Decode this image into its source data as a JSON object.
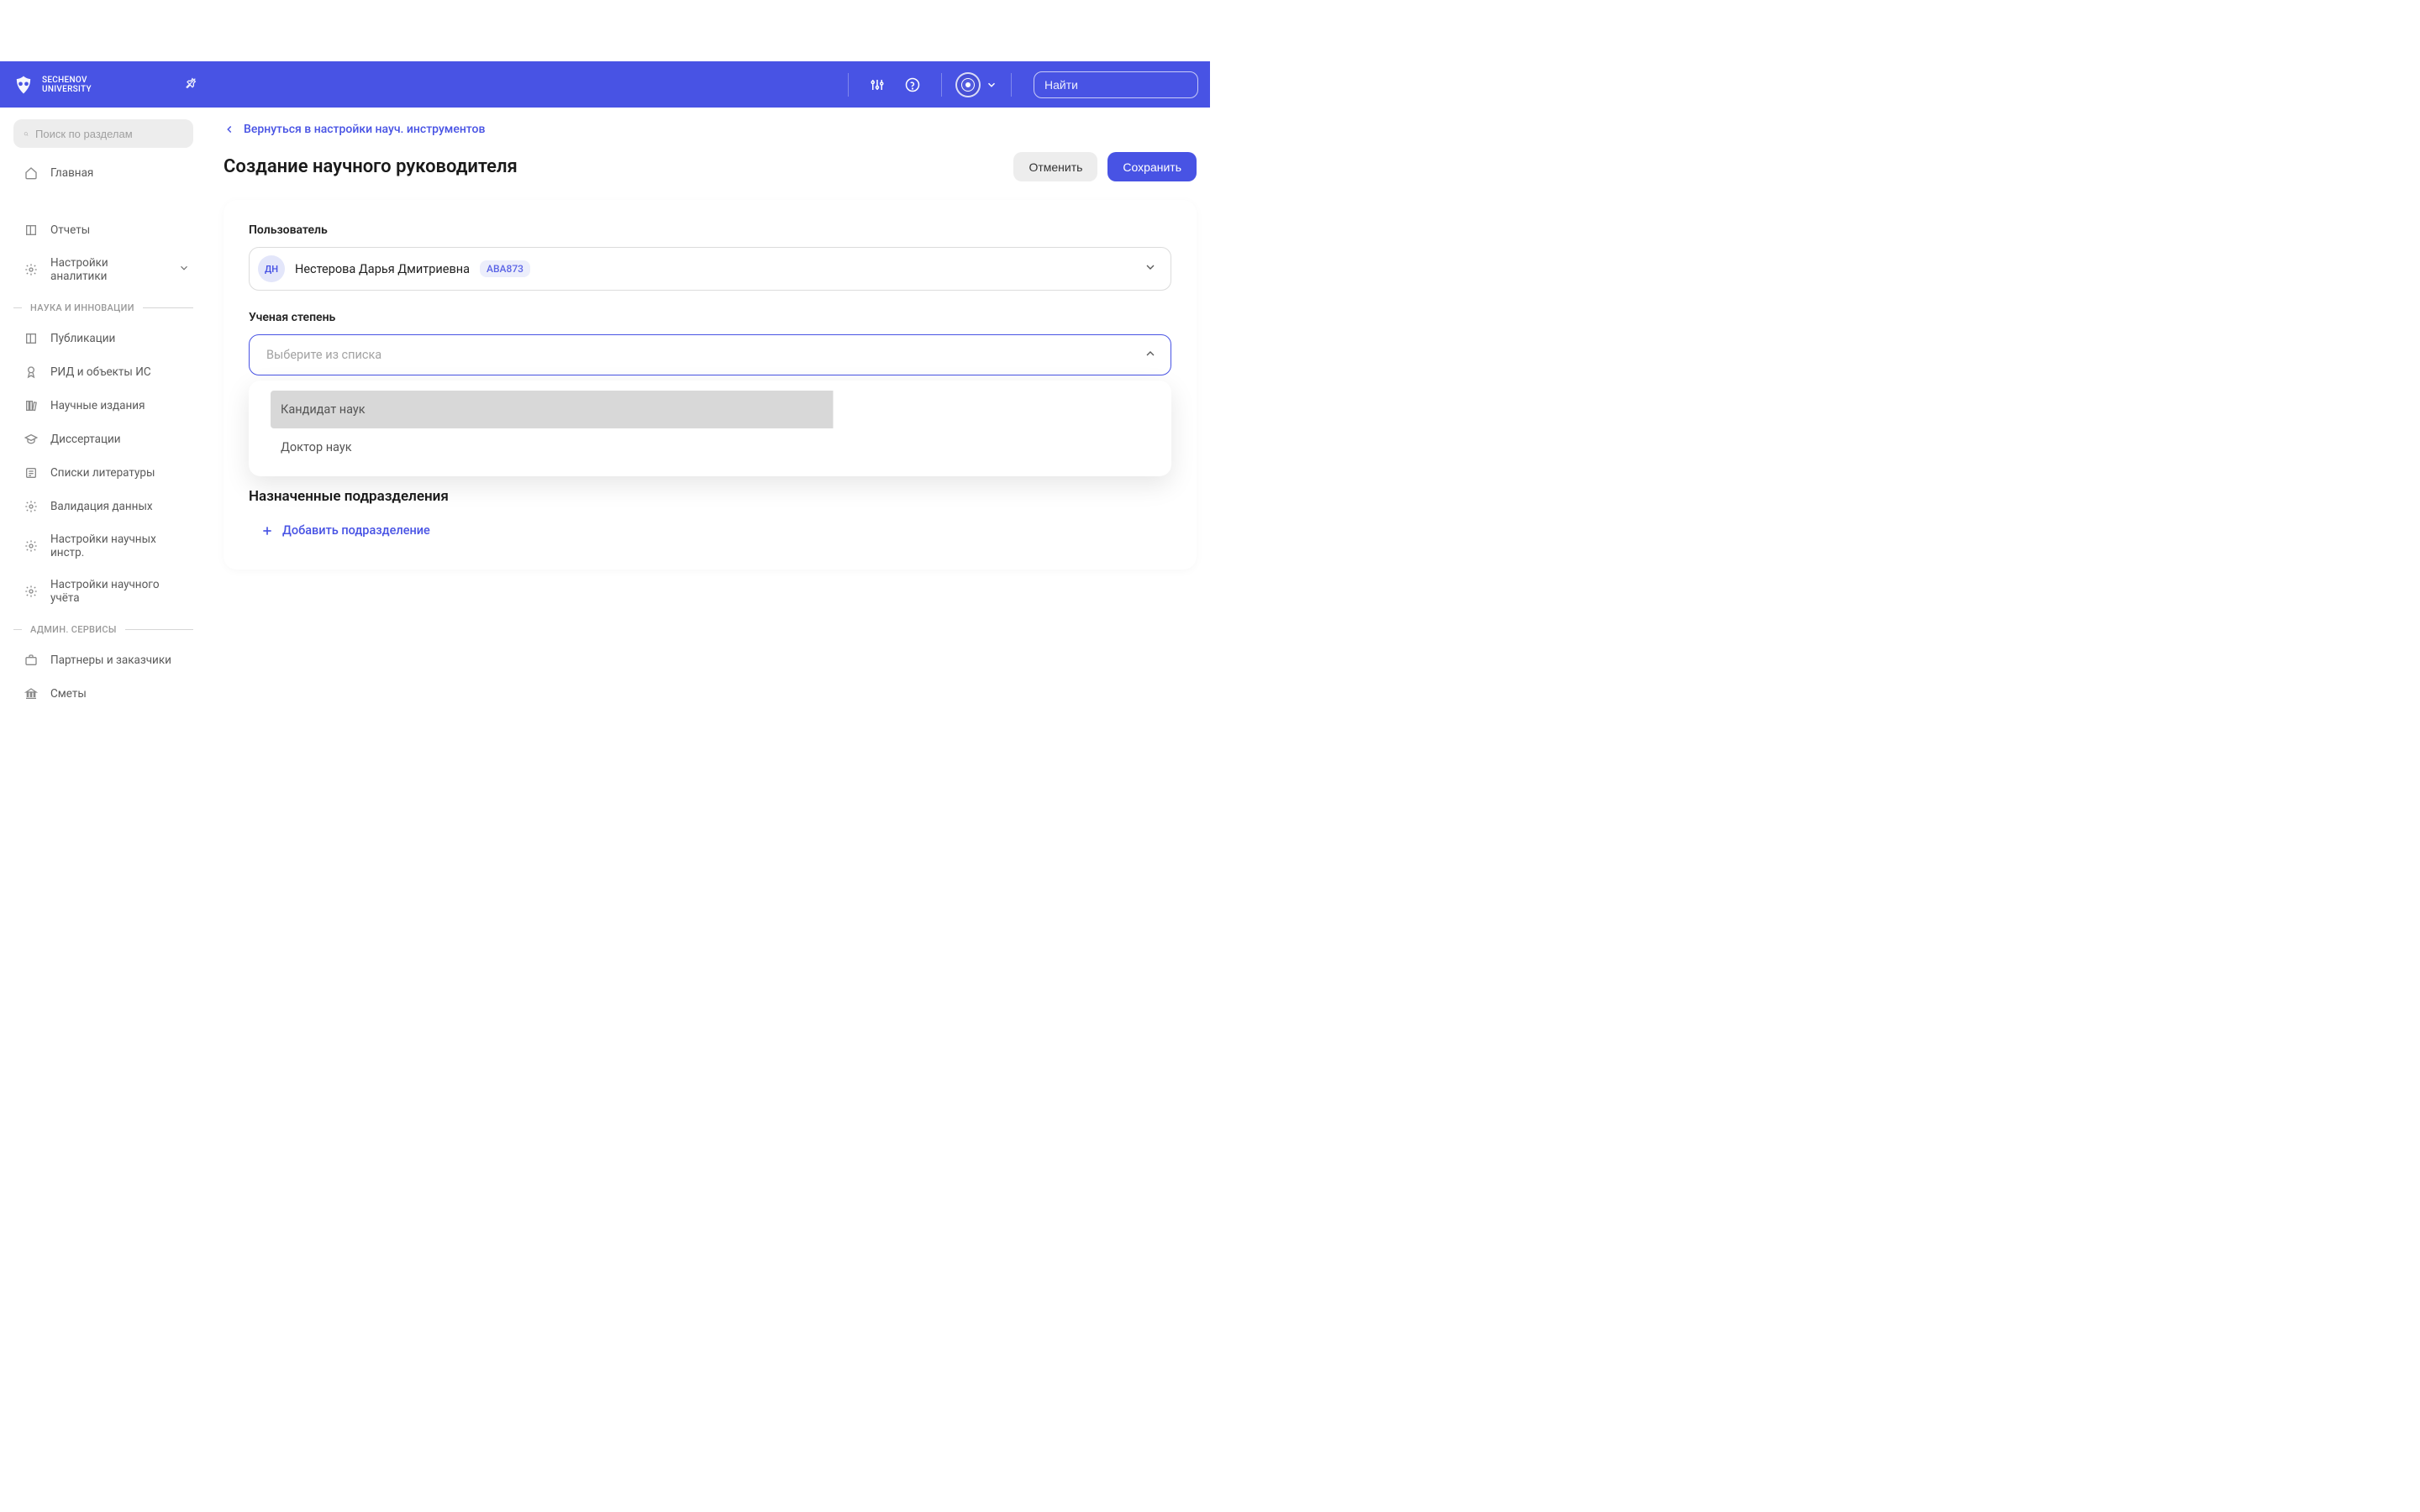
{
  "header": {
    "logo_line1": "SECHENOV",
    "logo_line2": "UNIVERSITY",
    "search_placeholder": "Найти"
  },
  "sidebar": {
    "search_placeholder": "Поиск по разделам",
    "items_top": [
      {
        "icon": "home",
        "label": "Главная"
      },
      {
        "icon": "book",
        "label": "Отчеты"
      },
      {
        "icon": "gear",
        "label": "Настройки аналитики",
        "expandable": true
      }
    ],
    "section_science": "НАУКА И ИННОВАЦИИ",
    "items_science": [
      {
        "icon": "book",
        "label": "Публикации"
      },
      {
        "icon": "award",
        "label": "РИД и объекты ИС"
      },
      {
        "icon": "books",
        "label": "Научные издания"
      },
      {
        "icon": "graduation",
        "label": "Диссертации"
      },
      {
        "icon": "list",
        "label": "Списки литературы"
      },
      {
        "icon": "gear",
        "label": "Валидация данных"
      },
      {
        "icon": "gear",
        "label": "Настройки научных инстр."
      },
      {
        "icon": "gear",
        "label": "Настройки научного учёта"
      }
    ],
    "section_admin": "АДМИН. СЕРВИСЫ",
    "items_admin": [
      {
        "icon": "briefcase",
        "label": "Партнеры и заказчики"
      },
      {
        "icon": "bank",
        "label": "Сметы"
      }
    ]
  },
  "main": {
    "back_link": "Вернуться в настройки науч. инструментов",
    "title": "Создание научного руководителя",
    "cancel": "Отменить",
    "save": "Сохранить",
    "field_user": "Пользователь",
    "user_initials": "ДН",
    "user_name": "Нестерова Дарья Дмитриевна",
    "user_code": "ABA873",
    "field_degree": "Ученая степень",
    "degree_placeholder": "Выберите из списка",
    "degree_options": [
      "Кандидат наук",
      "Доктор наук"
    ],
    "section_departments": "Назначенные подразделения",
    "add_department": "Добавить подразделение"
  }
}
